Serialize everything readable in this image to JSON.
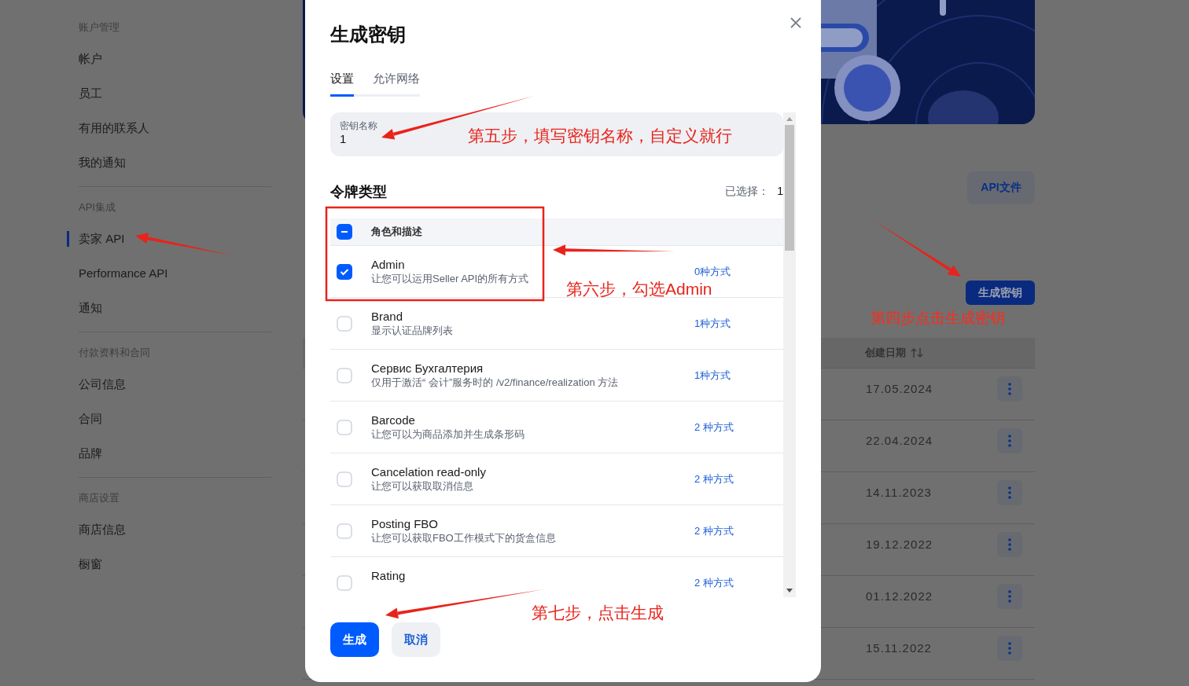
{
  "sidebar": {
    "groups": [
      {
        "label": "账户管理",
        "items": [
          {
            "label": "帐户",
            "selected": false
          },
          {
            "label": "员工",
            "selected": false
          },
          {
            "label": "有用的联系人",
            "selected": false
          },
          {
            "label": "我的通知",
            "selected": false
          }
        ]
      },
      {
        "label": "API集成",
        "items": [
          {
            "label": "卖家 API",
            "selected": true
          },
          {
            "label": "Performance API",
            "selected": false
          },
          {
            "label": "通知",
            "selected": false
          }
        ]
      },
      {
        "label": "付款资料和合同",
        "items": [
          {
            "label": "公司信息",
            "selected": false
          },
          {
            "label": "合同",
            "selected": false
          },
          {
            "label": "品牌",
            "selected": false
          }
        ]
      },
      {
        "label": "商店设置",
        "items": [
          {
            "label": "商店信息",
            "selected": false
          },
          {
            "label": "橱窗",
            "selected": false
          }
        ]
      }
    ]
  },
  "main": {
    "docs_button": "API文件",
    "generate_button": "生成密钥",
    "table": {
      "columns": [
        "创建日期"
      ],
      "rows": [
        {
          "created": "17.05.2024"
        },
        {
          "created": "22.04.2024"
        },
        {
          "created": "14.11.2023"
        },
        {
          "created": "19.12.2022"
        },
        {
          "created": "01.12.2022"
        },
        {
          "created": "15.11.2022"
        }
      ]
    }
  },
  "modal": {
    "title": "生成密钥",
    "tabs": [
      {
        "label": "设置",
        "selected": true
      },
      {
        "label": "允许网络",
        "selected": false
      }
    ],
    "key_name": {
      "label": "密钥名称",
      "value": "1"
    },
    "token_types": {
      "title": "令牌类型",
      "selected_label": "已选择：",
      "selected_count": "1",
      "header": {
        "label": "角色和描述",
        "indeterminate": true
      },
      "rows": [
        {
          "name": "Admin",
          "description": "让您可以运用Seller API的所有方式",
          "methods": "0种方式",
          "checked": true
        },
        {
          "name": "Brand",
          "description": "显示认证品牌列表",
          "methods": "1种方式",
          "checked": false
        },
        {
          "name": "Сервис Бухгалтерия",
          "description": "仅用于激活“ 会计”服务时的 /v2/finance/realization 方法",
          "methods": "1种方式",
          "checked": false
        },
        {
          "name": "Barcode",
          "description": "让您可以为商品添加并生成条形码",
          "methods": "2 种方式",
          "checked": false
        },
        {
          "name": "Cancelation read-only",
          "description": "让您可以获取取消信息",
          "methods": "2 种方式",
          "checked": false
        },
        {
          "name": "Posting FBO",
          "description": "让您可以获取FBO工作模式下的货盒信息",
          "methods": "2 种方式",
          "checked": false
        },
        {
          "name": "Rating",
          "methods": "2 种方式",
          "checked": false
        }
      ]
    },
    "buttons": [
      {
        "label": "生成",
        "kind": "primary"
      },
      {
        "label": "取消",
        "kind": "secondary"
      }
    ]
  },
  "annotations": [
    {
      "text": "第四步点击生成密钥"
    },
    {
      "text": "第五步，填写密钥名称，自定义就行"
    },
    {
      "text": "第六步，勾选Admin"
    },
    {
      "text": "第七步，点击生成"
    }
  ]
}
